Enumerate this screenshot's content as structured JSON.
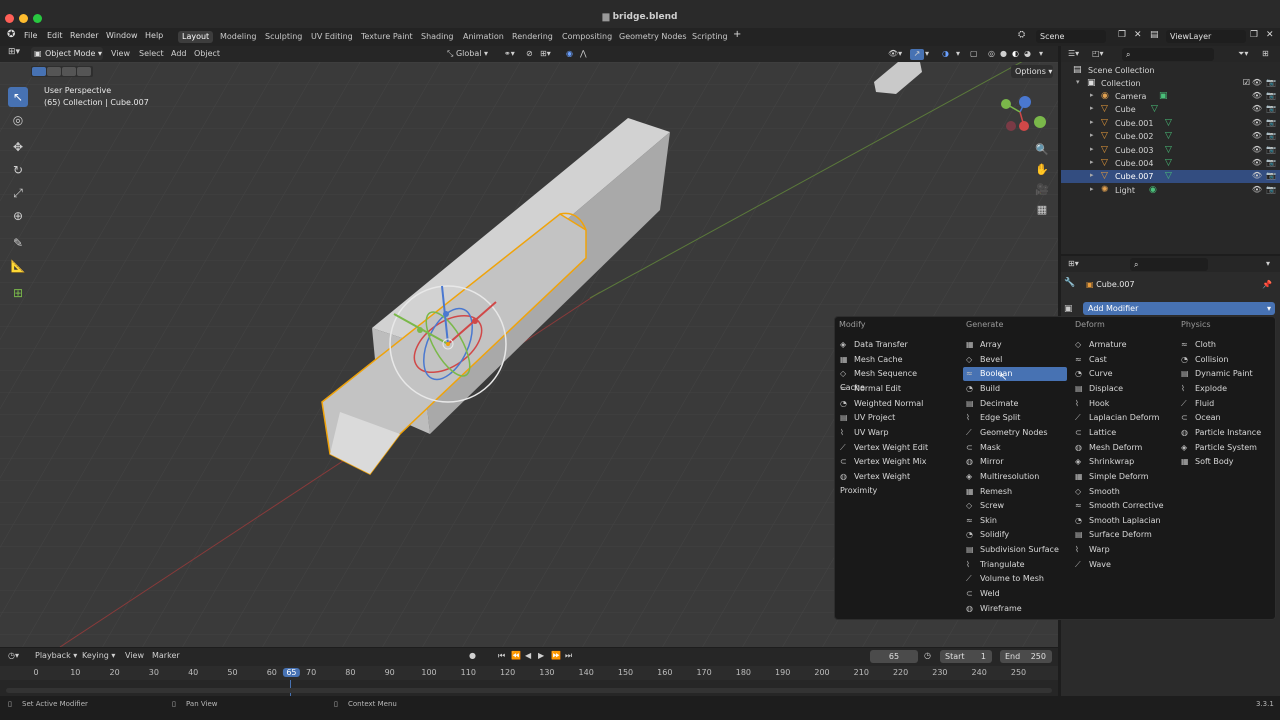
{
  "window": {
    "title": "bridge.blend"
  },
  "menu": [
    "File",
    "Edit",
    "Render",
    "Window",
    "Help"
  ],
  "workspaces": [
    "Layout",
    "Modeling",
    "Sculpting",
    "UV Editing",
    "Texture Paint",
    "Shading",
    "Animation",
    "Rendering",
    "Compositing",
    "Geometry Nodes",
    "Scripting"
  ],
  "active_workspace": "Layout",
  "scene_label": "Scene",
  "viewlayer_label": "ViewLayer",
  "viewport_header": {
    "mode": "Object Mode",
    "menus": [
      "View",
      "Select",
      "Add",
      "Object"
    ],
    "transform": "Global",
    "options_label": "Options"
  },
  "viewport_overlay": {
    "line1": "User Perspective",
    "line2": "(65) Collection | Cube.007"
  },
  "outliner": {
    "root": "Scene Collection",
    "collection": "Collection",
    "items": [
      {
        "name": "Camera",
        "icon": "camera-icon",
        "selected": false
      },
      {
        "name": "Cube",
        "icon": "mesh-icon",
        "selected": false
      },
      {
        "name": "Cube.001",
        "icon": "mesh-icon",
        "selected": false
      },
      {
        "name": "Cube.002",
        "icon": "mesh-icon",
        "selected": false
      },
      {
        "name": "Cube.003",
        "icon": "mesh-icon",
        "selected": false
      },
      {
        "name": "Cube.004",
        "icon": "mesh-icon",
        "selected": false
      },
      {
        "name": "Cube.007",
        "icon": "mesh-icon",
        "selected": true
      },
      {
        "name": "Light",
        "icon": "light-icon",
        "selected": false
      }
    ]
  },
  "properties": {
    "object_name": "Cube.007",
    "add_modifier": "Add Modifier"
  },
  "modifier_menu": {
    "columns": [
      {
        "header": "Modify",
        "items": [
          "Data Transfer",
          "Mesh Cache",
          "Mesh Sequence Cache",
          "Normal Edit",
          "Weighted Normal",
          "UV Project",
          "UV Warp",
          "Vertex Weight Edit",
          "Vertex Weight Mix",
          "Vertex Weight Proximity"
        ]
      },
      {
        "header": "Generate",
        "items": [
          "Array",
          "Bevel",
          "Boolean",
          "Build",
          "Decimate",
          "Edge Split",
          "Geometry Nodes",
          "Mask",
          "Mirror",
          "Multiresolution",
          "Remesh",
          "Screw",
          "Skin",
          "Solidify",
          "Subdivision Surface",
          "Triangulate",
          "Volume to Mesh",
          "Weld",
          "Wireframe"
        ]
      },
      {
        "header": "Deform",
        "items": [
          "Armature",
          "Cast",
          "Curve",
          "Displace",
          "Hook",
          "Laplacian Deform",
          "Lattice",
          "Mesh Deform",
          "Shrinkwrap",
          "Simple Deform",
          "Smooth",
          "Smooth Corrective",
          "Smooth Laplacian",
          "Surface Deform",
          "Warp",
          "Wave"
        ]
      },
      {
        "header": "Physics",
        "items": [
          "Cloth",
          "Collision",
          "Dynamic Paint",
          "Explode",
          "Fluid",
          "Ocean",
          "Particle Instance",
          "Particle System",
          "Soft Body"
        ]
      }
    ],
    "highlighted": "Boolean"
  },
  "timeline": {
    "menus": [
      "Playback",
      "Keying",
      "View",
      "Marker"
    ],
    "current_frame": "65",
    "start_label": "Start",
    "start": "1",
    "end_label": "End",
    "end": "250",
    "ticks": [
      "0",
      "10",
      "20",
      "30",
      "40",
      "50",
      "60",
      "65",
      "70",
      "80",
      "90",
      "100",
      "110",
      "120",
      "130",
      "140",
      "150",
      "160",
      "170",
      "180",
      "190",
      "200",
      "210",
      "220",
      "230",
      "240",
      "250"
    ]
  },
  "status_bar": {
    "left": "Set Active Modifier",
    "middle": "Pan View",
    "right": "Context Menu",
    "version": "3.3.1"
  },
  "colors": {
    "accent": "#4772b3",
    "selection_outline": "#f0a30a",
    "viewport_bg": "#3a3a3a"
  }
}
